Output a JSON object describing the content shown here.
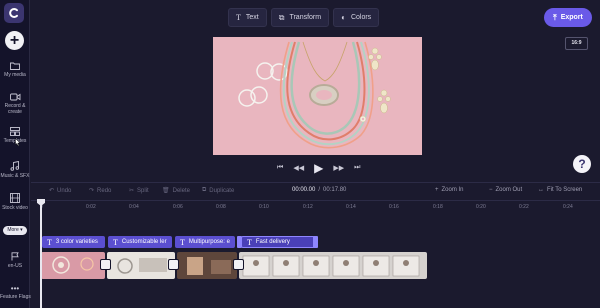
{
  "sidebar": {
    "items": [
      {
        "label": "My media",
        "icon": "folder-icon"
      },
      {
        "label": "Record & create",
        "icon": "video-camera-icon"
      },
      {
        "label": "Templates",
        "icon": "templates-icon"
      },
      {
        "label": "Music & SFX",
        "icon": "music-note-icon"
      },
      {
        "label": "Stock video",
        "icon": "film-icon"
      },
      {
        "label": "en-US",
        "icon": "flag-icon"
      },
      {
        "label": "Feature Flags",
        "icon": "more-dots-icon"
      }
    ],
    "more_label": "More"
  },
  "toolbar": {
    "text_label": "Text",
    "transform_label": "Transform",
    "colors_label": "Colors",
    "export_label": "Export"
  },
  "aspect_ratio": "16:9",
  "timeline": {
    "undo": "Undo",
    "redo": "Redo",
    "split": "Split",
    "delete": "Delete",
    "duplicate": "Duplicate",
    "current_time": "00:00.00",
    "total_time": "00:17.80",
    "zoom_in": "Zoom In",
    "zoom_out": "Zoom Out",
    "fit": "Fit To Screen",
    "ruler_ticks": [
      "0",
      "0:02",
      "0:04",
      "0:06",
      "0:08",
      "0:10",
      "0:12",
      "0:14",
      "0:16",
      "0:18",
      "0:20",
      "0:22",
      "0:24"
    ]
  },
  "text_clips": [
    {
      "label": "3 color varieties"
    },
    {
      "label": "Customizable ler"
    },
    {
      "label": "Multipurpose: e"
    },
    {
      "label": "Fast delivery"
    }
  ],
  "colors": {
    "accent": "#6a5ae8",
    "background": "#1b1a2e",
    "text_clip": "#5b4fd0",
    "preview_bg": "#e8b4bd"
  }
}
